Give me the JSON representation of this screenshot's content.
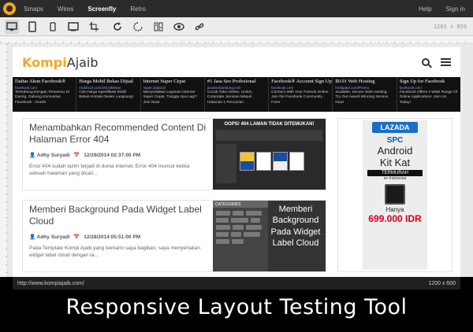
{
  "topnav": {
    "items": [
      "Smaps",
      "Wires",
      "Screenfly",
      "Retro"
    ],
    "active": "Screenfly",
    "help": "Help",
    "signin": "Sign in"
  },
  "toolbar": {
    "resolution": "1263 x 859",
    "icons": [
      "desktop-icon",
      "tablet-icon",
      "mobile-icon",
      "television-icon",
      "custom-size-icon",
      "rotate-icon",
      "refresh-icon",
      "scroll-icon",
      "proxy-icon",
      "share-link-icon"
    ]
  },
  "site": {
    "brand_first": "Kompi",
    "brand_second": "Ajaib",
    "ads": [
      {
        "title": "Daftar Akun Facebook®",
        "url": "facebook.com",
        "desc": "Terhubung Dengan Temanmu Di Daring, Gabung Komunitas Facebook - Gratis!"
      },
      {
        "title": "Harga Mobil Bekas Dijual",
        "url": "mobil123.com/2014/Bekas",
        "desc": "Cek Harga Spesifikasi Mobil Bekas Kontak Dealer Langsung!"
      },
      {
        "title": "Internet Super Cepat",
        "url": "super.cepat.id",
        "desc": "Menyediakan Layanan Internet Super Cepat, Tunggu Apa Lagi? Join Now!"
      },
      {
        "title": "#1 Jasa Seo Profesional",
        "url": "jasaseobandung.com",
        "desc": "Cocok Toko Online, Umkm, Corporate Jaminan Masuk Halaman 1 Pencarian"
      },
      {
        "title": "Facebook® Account Sign Up",
        "url": "facebook.com",
        "desc": "Connect With Your Friends Online. Join the Facebook Community - Free!"
      },
      {
        "title": "$0.01 Web Hosting",
        "url": "hostgator.com/Promo",
        "desc": "Scalable, Secure Web Hosting. Try Our Award-Winning Service Now!"
      },
      {
        "title": "Sign Up for Facebook",
        "url": "facebook.com",
        "desc": "Facebook Offers A Wide Range Of Online Applications. Join Us Today!"
      }
    ],
    "posts": [
      {
        "title": "Menambahkan Recommended Content Di Halaman Error 404",
        "author": "Adhy Suryadi",
        "datetime": "12/29/2014 02:37:00 PM",
        "excerpt": "Error 404 sudah lazim terjadi di dunia internet. Error 404 muncul ketika sebuah halaman yang dicari...",
        "thumb_banner": "OOPS! 404 LAMAN TIDAK DITEMUKAN!"
      },
      {
        "title": "Memberi Background Pada Widget Label Cloud",
        "author": "Adhy Suryadi",
        "datetime": "12/28/2014 05:51:00 PM",
        "excerpt": "Pada Template Kompi Ajaib yang kemarin saya bagikan, saya menyertakan widget label cloud dengan ta...",
        "thumb_header": "CATEGORIES",
        "thumb_text": "Memberi Background Pada Widget Label Cloud"
      }
    ],
    "sidebar_ad": {
      "brand": "LAZADA",
      "maker": "SPC",
      "line1": "Android",
      "line2": "Kit Kat",
      "ribbon": "TERMURAH",
      "region": "se-Indonesia",
      "price_label": "Hanya",
      "price": "699.000 IDR"
    }
  },
  "statusbar": {
    "url": "http://www.kompiajaib.com/",
    "size": "1200 x 600"
  },
  "caption": "Responsive Layout Testing Tool"
}
